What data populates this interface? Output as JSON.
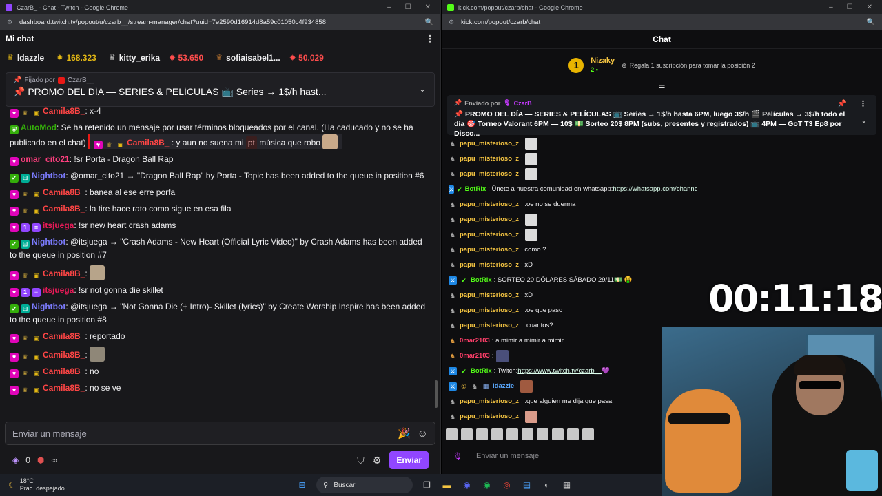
{
  "twitch_window": {
    "title": "CzarB_ - Chat - Twitch - Google Chrome",
    "url": "dashboard.twitch.tv/popout/u/czarb__/stream-manager/chat?uuid=7e2590d16914d8a59c01050c4f934858",
    "header_title": "Mi chat",
    "leaders": [
      {
        "name": "ldazzle",
        "value": ""
      },
      {
        "name": "",
        "value": "168.323"
      },
      {
        "name": "kitty_erika",
        "value": "53.650"
      },
      {
        "name": "sofiaisabel1...",
        "value": "50.029"
      }
    ],
    "pinned": {
      "label": "Fijado por",
      "author": "CzarB__",
      "text": "📌 PROMO DEL DÍA — SERIES & PELÍCULAS 📺 Series → 1$/h hast..."
    },
    "messages": [
      {
        "user": "Camila8B_",
        "color": "#ff4545",
        "text": ": x-4"
      },
      {
        "user": "AutoMod",
        "color": "#34ae0a",
        "text": ": Se ha retenido un mensaje por usar términos bloqueados por el canal. (Ha caducado y no se ha publicado en el chat)",
        "held_user": "Camila8B_",
        "held_text": ": y aun no suena mi",
        "held_tag": "pt",
        "held_text2": "música que robo"
      },
      {
        "user": "omar_cito21",
        "color": "#ff3f7f",
        "text": ": !sr Porta - Dragon Ball Rap"
      },
      {
        "user": "Nightbot",
        "color": "#7c7cff",
        "text": ": @omar_cito21 → \"Dragon Ball Rap\" by Porta - Topic has been added to the queue in position #6"
      },
      {
        "user": "Camila8B_",
        "color": "#ff4545",
        "text": ": banea al ese erre porfa"
      },
      {
        "user": "Camila8B_",
        "color": "#ff4545",
        "text": ": la tire hace rato como sigue en esa fila"
      },
      {
        "user": "itsjuega",
        "color": "#e91a58",
        "text": ": !sr new heart crash adams"
      },
      {
        "user": "Nightbot",
        "color": "#7c7cff",
        "text": ": @itsjuega → \"Crash Adams - New Heart (Official Lyric Video)\" by Crash Adams has been added to the queue in position #7"
      },
      {
        "user": "Camila8B_",
        "color": "#ff4545",
        "text": ":"
      },
      {
        "user": "itsjuega",
        "color": "#e91a58",
        "text": ": !sr not gonna die skillet"
      },
      {
        "user": "Nightbot",
        "color": "#7c7cff",
        "text": ": @itsjuega → \"Not Gonna Die (+ Intro)- Skillet (lyrics)\" by Create Worship Inspire has been added to the queue in position #8"
      },
      {
        "user": "Camila8B_",
        "color": "#ff4545",
        "text": ": reportado"
      },
      {
        "user": "Camila8B_",
        "color": "#ff4545",
        "text": ":"
      },
      {
        "user": "Camila8B_",
        "color": "#ff4545",
        "text": ": no"
      },
      {
        "user": "Camila8B_",
        "color": "#ff4545",
        "text": ": no se ve"
      }
    ],
    "input_placeholder": "Enviar un mensaje",
    "points": "0",
    "points_infinity": "∞",
    "send_label": "Enviar"
  },
  "kick_window": {
    "title": "kick.com/popout/czarb/chat - Google Chrome",
    "url": "kick.com/popout/czarb/chat",
    "header_title": "Chat",
    "goal": {
      "position": "1",
      "user": "Nizaky",
      "count": "2",
      "hint": "Regala 1 suscripción para tomar la posición 2"
    },
    "pinned": {
      "label": "Enviado por",
      "author": "CzarB",
      "text": "📌 PROMO DEL DÍA — SERIES & PELÍCULAS 📺 Series → 1$/h hasta 6PM, luego 3$/h 🎬 Películas → 3$/h todo el día 🎯 Torneo Valorant 6PM — 10$ 💵 Sorteo 20$ 8PM (subs, presentes y registrados) 📺 4PM — GoT T3 Ep8 por Disco..."
    },
    "messages": [
      {
        "user": "papu_misterioso_z",
        "color": "#f5c542",
        "text": ":",
        "emote": true
      },
      {
        "user": "papu_misterioso_z",
        "color": "#f5c542",
        "text": ":",
        "emote": true
      },
      {
        "user": "papu_misterioso_z",
        "color": "#f5c542",
        "text": ":",
        "emote": true
      },
      {
        "user": "BotRix",
        "color": "#53fc18",
        "text": ": Únete a nuestra comunidad en whatsapp: ",
        "link": "https://whatsapp.com/channel/0029Va8edn1HAdNMhxit7i2q"
      },
      {
        "user": "papu_misterioso_z",
        "color": "#f5c542",
        "text": ": .oe no se duerma"
      },
      {
        "user": "papu_misterioso_z",
        "color": "#f5c542",
        "text": ":",
        "emote": true
      },
      {
        "user": "papu_misterioso_z",
        "color": "#f5c542",
        "text": ":",
        "emote": true
      },
      {
        "user": "papu_misterioso_z",
        "color": "#f5c542",
        "text": ": como ?"
      },
      {
        "user": "papu_misterioso_z",
        "color": "#f5c542",
        "text": ": xD"
      },
      {
        "user": "BotRix",
        "color": "#53fc18",
        "text": ": SORTEO 20 DÓLARES SÁBADO 29/11💵 🤑"
      },
      {
        "user": "papu_misterioso_z",
        "color": "#f5c542",
        "text": ": xD"
      },
      {
        "user": "papu_misterioso_z",
        "color": "#f5c542",
        "text": ": .oe que paso"
      },
      {
        "user": "papu_misterioso_z",
        "color": "#f5c542",
        "text": ": .cuantos?"
      },
      {
        "user": "0mar2103",
        "color": "#ff3f6a",
        "text": ": a mimir a mimir a mimir"
      },
      {
        "user": "0mar2103",
        "color": "#ff3f6a",
        "text": ":",
        "emote": true
      },
      {
        "user": "BotRix",
        "color": "#53fc18",
        "text": ": Twitch: ",
        "link": "https://www.twitch.tv/czarb__",
        "suffix": " 💜"
      },
      {
        "user": "ldazzle",
        "color": "#5aa9ff",
        "text": ":",
        "emote": true
      },
      {
        "user": "papu_misterioso_z",
        "color": "#f5c542",
        "text": ": .que alguien me dija que pasa"
      },
      {
        "user": "papu_misterioso_z",
        "color": "#f5c542",
        "text": ":",
        "emote": true
      }
    ],
    "input_placeholder": "Enviar un mensaje"
  },
  "overlay": {
    "timer": "00:11:18"
  },
  "taskbar": {
    "temp": "18°C",
    "weather": "Prac. despejado",
    "search": "Buscar"
  },
  "colors": {
    "twitch_purple": "#9146ff",
    "kick_green": "#53fc18",
    "chrome_dark": "#202124"
  }
}
